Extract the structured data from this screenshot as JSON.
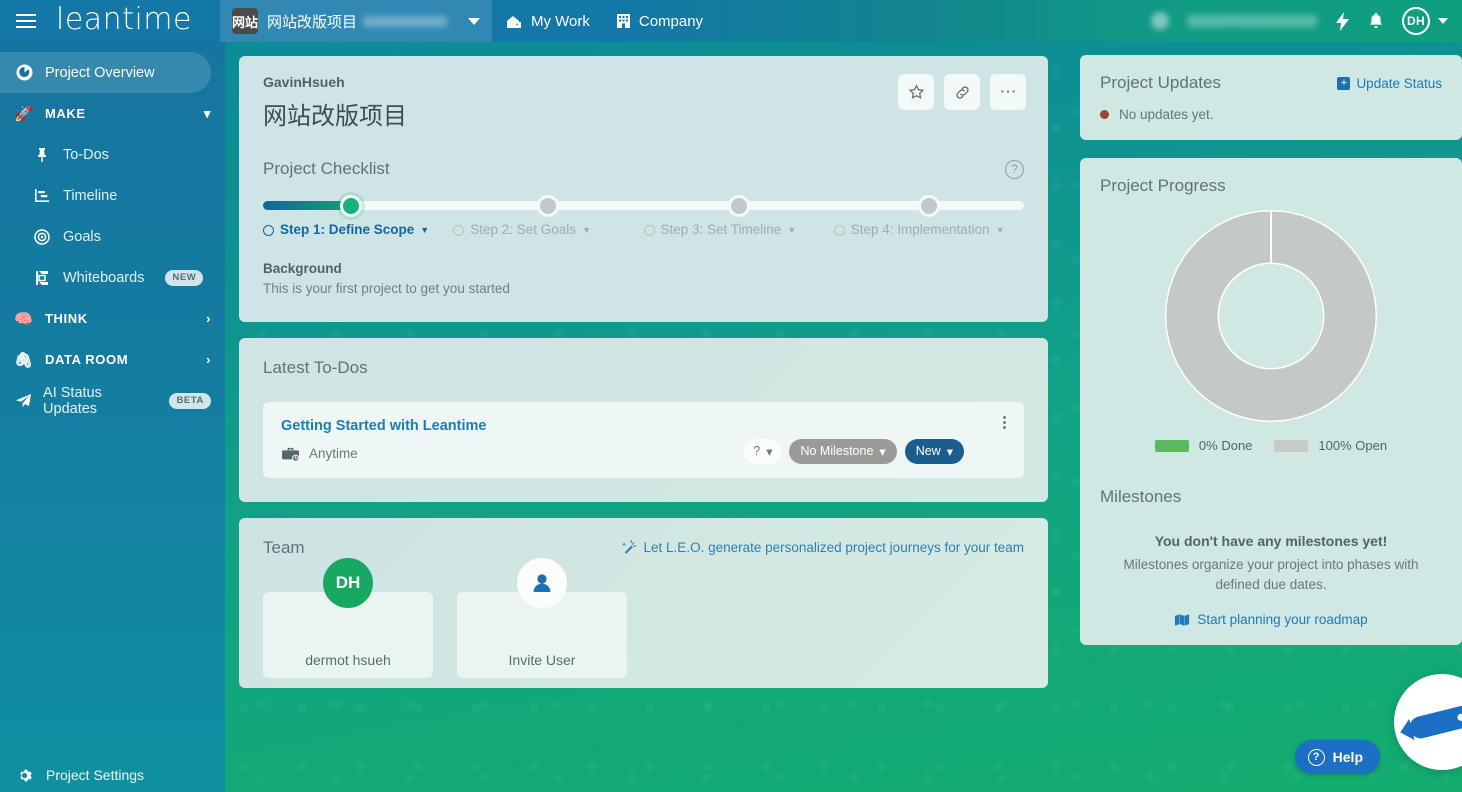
{
  "topbar": {
    "menu_icon": "hamburger-icon",
    "brand": "leantime",
    "project_selector": {
      "avatar_text": "网站",
      "project_name": "网站改版项目",
      "caret": "chevron-down-icon"
    },
    "nav": [
      {
        "label": "My Work",
        "icon": "home-work-icon"
      },
      {
        "label": "Company",
        "icon": "building-icon"
      }
    ],
    "right": {
      "lightning_icon": "lightning-bolt-icon",
      "bell_icon": "bell-icon",
      "avatar_initials": "DH",
      "avatar_caret": "chevron-down-icon"
    }
  },
  "sidebar": {
    "active": "Project Overview",
    "items": [
      {
        "label": "Project Overview",
        "icon": "dashboard-icon",
        "type": "item",
        "active": true
      },
      {
        "label": "MAKE",
        "icon": "rocket-icon",
        "type": "group",
        "chevron": "chevron-down-icon"
      },
      {
        "label": "To-Dos",
        "icon": "pin-icon",
        "type": "sub"
      },
      {
        "label": "Timeline",
        "icon": "timeline-chart-icon",
        "type": "sub"
      },
      {
        "label": "Goals",
        "icon": "target-icon",
        "type": "sub"
      },
      {
        "label": "Whiteboards",
        "icon": "whiteboard-icon",
        "type": "sub",
        "badge": "NEW"
      },
      {
        "label": "THINK",
        "icon": "brain-icon",
        "type": "group",
        "chevron": "chevron-right-icon"
      },
      {
        "label": "DATA ROOM",
        "icon": "paperclip-icon",
        "type": "group",
        "chevron": "chevron-right-icon"
      },
      {
        "label": "AI Status Updates",
        "icon": "paper-plane-icon",
        "type": "item",
        "badge": "BETA"
      }
    ],
    "bottom": {
      "label": "Project Settings",
      "icon": "gear-icon"
    }
  },
  "main": {
    "header": {
      "owner": "GavinHsueh",
      "title": "网站改版项目",
      "actions": [
        {
          "name": "favorite-button",
          "icon": "star-icon",
          "glyph": "☆"
        },
        {
          "name": "copy-link-button",
          "icon": "link-icon",
          "glyph": "🔗"
        },
        {
          "name": "more-options-button",
          "icon": "ellipsis-icon",
          "glyph": "•••"
        }
      ]
    },
    "checklist": {
      "title": "Project Checklist",
      "help_icon": "question-mark-icon",
      "progress_percent": 11.5,
      "steps": [
        {
          "label": "Step 1: Define Scope",
          "state": "current",
          "left_pct": 11.5
        },
        {
          "label": "Step 2: Set Goals",
          "state": "pending",
          "left_pct": 37.5
        },
        {
          "label": "Step 3: Set Timeline",
          "state": "pending",
          "left_pct": 62.5
        },
        {
          "label": "Step 4: Implementation",
          "state": "pending",
          "left_pct": 87.5
        }
      ],
      "background_label": "Background",
      "background_text": "This is your first project to get you started"
    },
    "todos": {
      "title": "Latest To-Dos",
      "items": [
        {
          "title": "Getting Started with Leantime",
          "due": "Anytime",
          "due_icon": "briefcase-clock-icon",
          "priority_label": "?",
          "milestone_label": "No Milestone",
          "status_label": "New",
          "kebab_icon": "kebab-menu-icon"
        }
      ]
    },
    "team": {
      "title": "Team",
      "leo_link": "Let L.E.O. generate personalized project journeys for your team",
      "leo_icon": "magic-wand-icon",
      "members": [
        {
          "initials": "DH",
          "name": "dermot hsueh",
          "type": "member"
        },
        {
          "initials": "",
          "name": "Invite User",
          "type": "invite",
          "icon": "user-add-icon"
        }
      ]
    }
  },
  "rail": {
    "updates": {
      "title": "Project Updates",
      "action_label": "Update Status",
      "action_icon": "plus-icon",
      "empty_text": "No updates yet.",
      "status_dot_color": "#9c4436"
    },
    "progress": {
      "title": "Project Progress",
      "legend": [
        {
          "label": "0% Done",
          "color": "#5bb85c"
        },
        {
          "label": "100% Open",
          "color": "#c6cacb"
        }
      ]
    },
    "milestones": {
      "title": "Milestones",
      "empty_title": "You don't have any milestones yet!",
      "empty_sub": "Milestones organize your project into phases with defined due dates.",
      "link_label": "Start planning your roadmap",
      "link_icon": "map-icon"
    }
  },
  "floating": {
    "help_label": "Help",
    "help_icon": "question-circle-icon",
    "chat_icon": "chat-pen-icon"
  },
  "chart_data": {
    "type": "pie",
    "title": "Project Progress",
    "categories": [
      "Done",
      "Open"
    ],
    "values": [
      0,
      100
    ],
    "colors": [
      "#5bb85c",
      "#c6cacb"
    ],
    "labels": [
      "0% Done",
      "100% Open"
    ],
    "donut": true,
    "legend_position": "bottom"
  }
}
